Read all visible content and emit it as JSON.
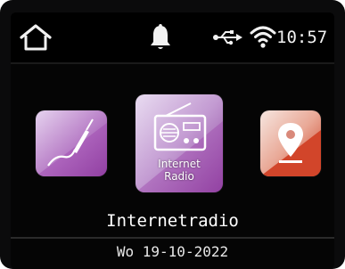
{
  "status_bar": {
    "time": "10:57",
    "icons": [
      "home-icon",
      "bell-icon",
      "usb-icon",
      "wifi-icon"
    ]
  },
  "menu": {
    "items": [
      {
        "id": "aux",
        "icon": "cable-icon",
        "caption_line1": "",
        "caption_line2": ""
      },
      {
        "id": "internet-radio",
        "icon": "radio-icon",
        "caption_line1": "Internet",
        "caption_line2": "Radio"
      },
      {
        "id": "local",
        "icon": "location-pin-icon",
        "caption_line1": "",
        "caption_line2": ""
      }
    ],
    "selected_index": 1
  },
  "title": "Internetradio",
  "date": "Wo 19-10-2022",
  "colors": {
    "background": "#050505",
    "text": "#ffffff",
    "tile_purple_light": "#d9c6e6",
    "tile_purple_dark": "#8a3b9a",
    "tile_red": "#d2452a"
  }
}
